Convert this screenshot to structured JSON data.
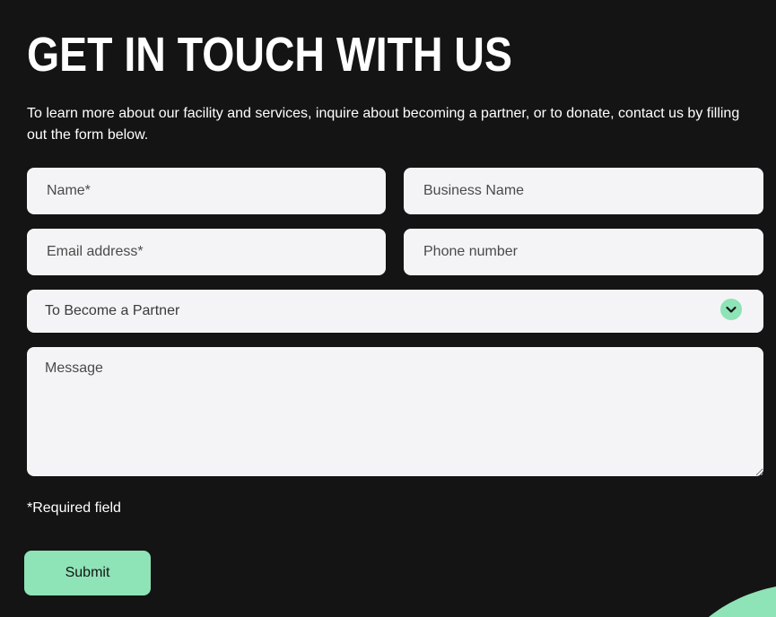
{
  "colors": {
    "background": "#141414",
    "field_background": "#f4f4f6",
    "accent": "#8ee3b7"
  },
  "header": {
    "title": "GET IN TOUCH WITH US",
    "intro": "To learn more about our facility and services, inquire about becoming a partner, or to donate, contact us by filling out the form below."
  },
  "form": {
    "name_placeholder": "Name*",
    "business_placeholder": "Business Name",
    "email_placeholder": "Email address*",
    "phone_placeholder": "Phone number",
    "inquiry_selected": "To Become a Partner",
    "inquiry_icon": "chevron-down-icon",
    "message_placeholder": "Message",
    "required_note": "*Required field",
    "submit_label": "Submit"
  }
}
